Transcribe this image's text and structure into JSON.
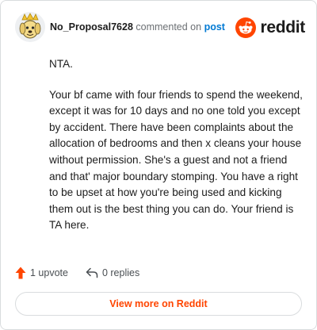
{
  "comment": {
    "author": "No_Proposal7628",
    "verb": "commented on",
    "link_text": "post",
    "avatar_icon": "user-avatar-icon",
    "paragraphs": [
      "NTA.",
      "Your bf came with four friends to spend the weekend, except it was for 10 days and no one told you except by accident. There have been complaints about the allocation of bedrooms and then x cleans your house without permission. She's a guest and not a friend and that' major boundary stomping. You have a right to be upset at how you're being used and kicking them out is the best thing you can do. Your friend is TA here."
    ]
  },
  "brand": {
    "wordmark": "reddit",
    "icon": "reddit-logo-icon",
    "color": "#ff4500"
  },
  "actions": {
    "upvote_label": "1 upvote",
    "upvote_icon": "upvote-arrow-icon",
    "upvote_color": "#ff4500",
    "replies_label": "0 replies",
    "replies_icon": "reply-arrow-icon"
  },
  "footer": {
    "view_more_label": "View more on Reddit"
  }
}
